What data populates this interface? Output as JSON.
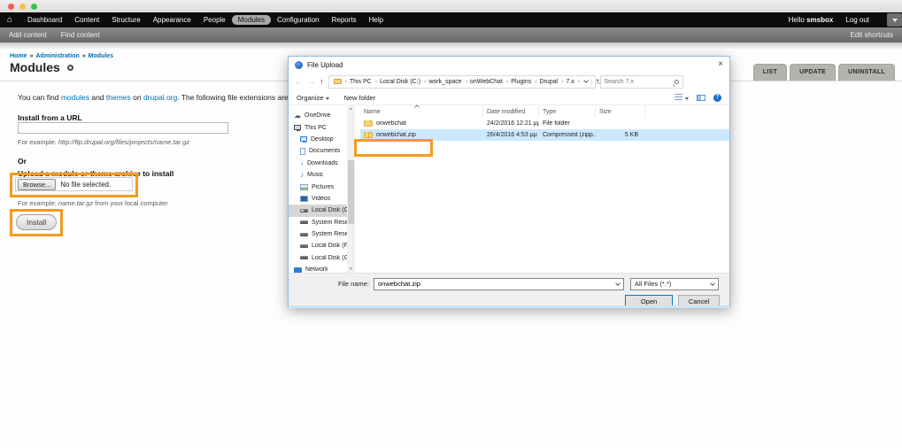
{
  "colors": {
    "highlight_orange": "#F59B1E",
    "selection_blue": "#CCE8FF",
    "link_blue": "#0071B3",
    "windows_accent_blue": "#0078D7"
  },
  "admin_bar": {
    "items": [
      "Dashboard",
      "Content",
      "Structure",
      "Appearance",
      "People",
      "Modules",
      "Configuration",
      "Reports",
      "Help"
    ],
    "active_item": "Modules",
    "greeting_prefix": "Hello ",
    "username": "smsbox",
    "logout_label": "Log out"
  },
  "shortcut_bar": {
    "add_content": "Add content",
    "find_content": "Find content",
    "edit_shortcuts": "Edit shortcuts"
  },
  "page": {
    "breadcrumb": [
      "Home",
      "Administration",
      "Modules"
    ],
    "title": "Modules",
    "tabs": [
      "LIST",
      "UPDATE",
      "UNINSTALL"
    ],
    "intro": {
      "part1": "You can find ",
      "link_modules": "modules",
      "part2": " and ",
      "link_themes": "themes",
      "part3": " on ",
      "link_drupal": "drupal.org",
      "part4": ". The following file extensions are suppor"
    },
    "install_url": {
      "heading": "Install from a URL",
      "input_value": "",
      "example_prefix": "For example: ",
      "example_url": "http://ftp.drupal.org/files/projects/name.tar.gz"
    },
    "or_label": "Or",
    "upload": {
      "heading": "Upload a module or theme archive to install",
      "browse_label": "Browse...",
      "no_file_label": "No file selected.",
      "example_prefix": "For example: ",
      "example_file": "name.tar.gz",
      "example_suffix": " from your local computer",
      "install_label": "Install"
    }
  },
  "dialog": {
    "title": "File Upload",
    "close_label": "×",
    "nav": {
      "back_icon": "←",
      "forward_icon": "→",
      "up_icon": "↑",
      "crumbs": [
        "This PC",
        "Local Disk (C:)",
        "work_space",
        "onWebChat",
        "Plugins",
        "Drupal",
        "7.x"
      ],
      "refresh_icon": "↻",
      "search_placeholder": "Search 7.x"
    },
    "toolbar": {
      "organize": "Organize",
      "new_folder": "New folder",
      "help_glyph": "?"
    },
    "columns": [
      "Name",
      "Date modified",
      "Type",
      "Size"
    ],
    "sidebar": [
      {
        "label": "OneDrive"
      },
      {
        "label": "This PC"
      },
      {
        "label": "Desktop"
      },
      {
        "label": "Documents"
      },
      {
        "label": "Downloads"
      },
      {
        "label": "Music"
      },
      {
        "label": "Pictures"
      },
      {
        "label": "Videos"
      },
      {
        "label": "Local Disk (C:)"
      },
      {
        "label": "System Reserved"
      },
      {
        "label": "System Reserved"
      },
      {
        "label": "Local Disk (F:)"
      },
      {
        "label": "Local Disk (G:)"
      },
      {
        "label": "Network"
      }
    ],
    "files": [
      {
        "name": "onwebchat",
        "date": "24/2/2016 12:21 μμ",
        "type": "File folder",
        "size": ""
      },
      {
        "name": "onwebchat.zip",
        "date": "26/4/2016 4:53 μμ",
        "type": "Compressed (zipp...",
        "size": "5 KB"
      }
    ],
    "footer": {
      "file_name_label": "File name:",
      "file_name_value": "onwebchat.zip",
      "file_type_value": "All Files (*.*)",
      "open_label": "Open",
      "cancel_label": "Cancel"
    }
  }
}
